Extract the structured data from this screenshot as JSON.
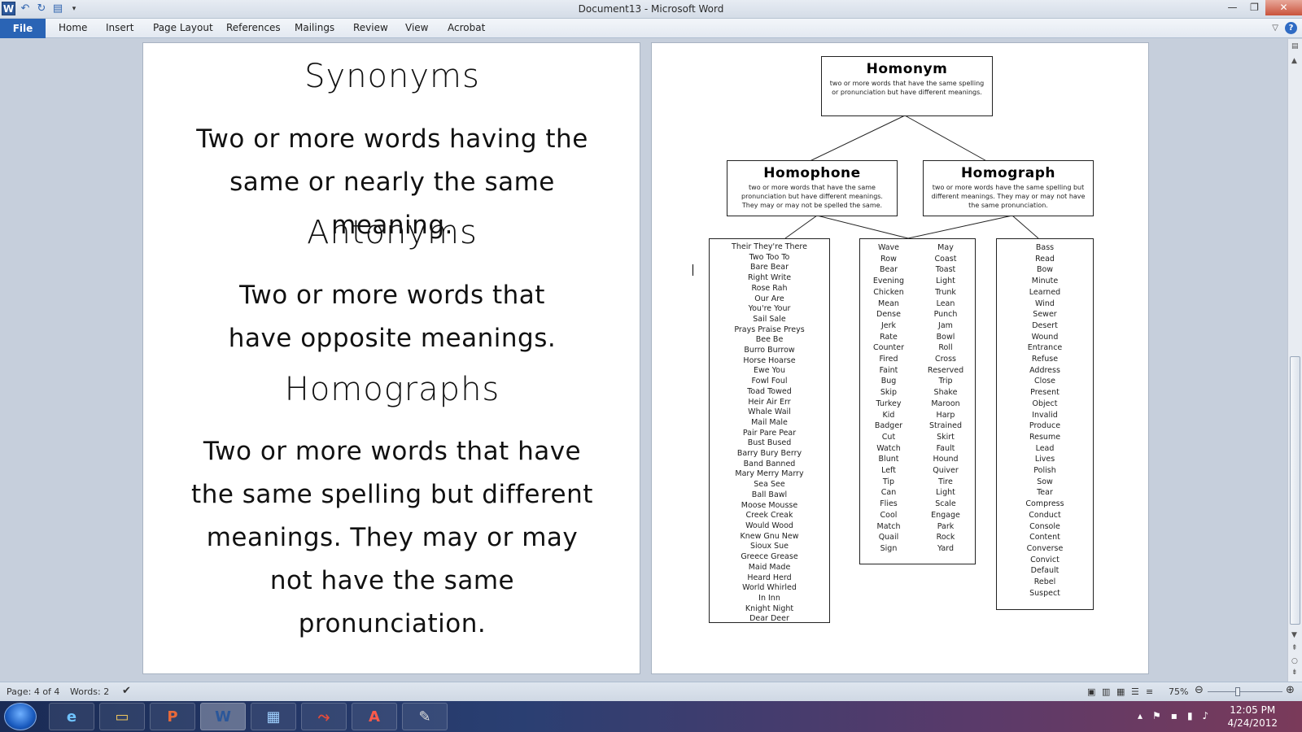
{
  "window": {
    "title": "Document13 - Microsoft Word"
  },
  "ribbon": {
    "file": "File",
    "tabs": [
      "Home",
      "Insert",
      "Page Layout",
      "References",
      "Mailings",
      "Review",
      "View",
      "Acrobat"
    ]
  },
  "page1": {
    "synonyms_title": "Synonyms",
    "synonyms_def": "Two or more words having the same or nearly the same meaning.",
    "antonyms_title": "Antonyms",
    "antonyms_def": "Two or more words that have opposite meanings.",
    "homographs_title": "Homographs",
    "homographs_def": "Two or more words that have the same spelling but different meanings. They may or may not have the same pronunciation."
  },
  "page2": {
    "homonym": {
      "title": "Homonym",
      "desc": "two or more words that have the same spelling or pronunciation but have different meanings."
    },
    "homophone": {
      "title": "Homophone",
      "desc": "two or more words that have the same pronunciation but have different meanings. They may or may not be spelled the same."
    },
    "homograph": {
      "title": "Homograph",
      "desc": "two or more words have the same spelling but different meanings. They may or may not have the same pronunciation."
    },
    "homophone_words": [
      "Their  They're  There",
      "Two  Too  To",
      "Bare Bear",
      "Right  Write",
      "Rose  Rah",
      "Our  Are",
      "You're  Your",
      "Sail  Sale",
      "Prays  Praise  Preys",
      "Bee  Be",
      "Burro  Burrow",
      "Horse  Hoarse",
      "Ewe  You",
      "Fowl  Foul",
      "Toad  Towed",
      "Heir  Air  Err",
      "Whale  Wail",
      "Mail  Male",
      "Pair  Pare  Pear",
      "Bust  Bused",
      "Barry  Bury  Berry",
      "Band  Banned",
      "Mary  Merry  Marry",
      "Sea  See",
      "Ball  Bawl",
      "Moose  Mousse",
      "Creek  Creak",
      "Would  Wood",
      "Knew  Gnu  New",
      "Sioux  Sue",
      "Greece  Grease",
      "Maid  Made",
      "Heard  Herd",
      "World  Whirled",
      "In  Inn",
      "Knight Night",
      "Dear  Deer"
    ],
    "middle_words_left": [
      "Wave",
      "Row",
      "Bear",
      "Evening",
      "Chicken",
      "Mean",
      "Dense",
      "Jerk",
      "Rate",
      "Counter",
      "Fired",
      "Faint",
      "Bug",
      "Skip",
      "Turkey",
      "Kid",
      "Badger",
      "Cut",
      "Watch",
      "Blunt",
      "Left",
      "Tip",
      "Can",
      "Flies",
      "Cool",
      "Match",
      "Quail",
      "Sign"
    ],
    "middle_words_right": [
      "May",
      "Coast",
      "Toast",
      "Light",
      "Trunk",
      "Lean",
      "Punch",
      "Jam",
      "Bowl",
      "Roll",
      "Cross",
      "Reserved",
      "Trip",
      "Shake",
      "Maroon",
      "Harp",
      "Strained",
      "Skirt",
      "Fault",
      "Hound",
      "Quiver",
      "Tire",
      "Light",
      "Scale",
      "Engage",
      "Park",
      "Rock",
      "Yard"
    ],
    "homograph_words": [
      "Bass",
      "Read",
      "Bow",
      "Minute",
      "Learned",
      "Wind",
      "Sewer",
      "Desert",
      "Wound",
      "Entrance",
      "Refuse",
      "Address",
      "Close",
      "Present",
      "Object",
      "Invalid",
      "Produce",
      "Resume",
      "Lead",
      "Lives",
      "Polish",
      "Sow",
      "Tear",
      "Compress",
      "Conduct",
      "Console",
      "Content",
      "Converse",
      "Convict",
      "Default",
      "Rebel",
      "Suspect"
    ]
  },
  "status": {
    "page": "Page: 4 of 4",
    "words": "Words: 2",
    "zoom": "75%"
  },
  "taskbar": {
    "time": "12:05 PM",
    "date": "4/24/2012"
  }
}
